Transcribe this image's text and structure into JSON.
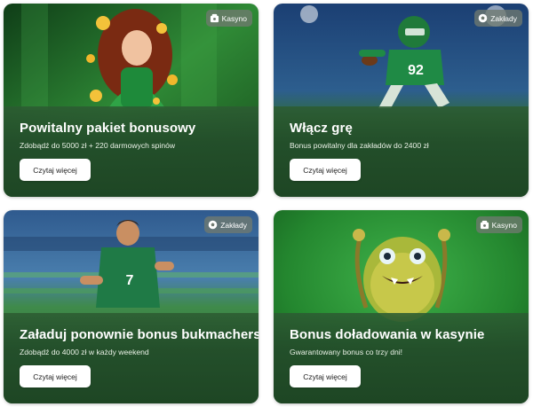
{
  "colors": {
    "panel": "#234e2a",
    "button_bg": "#ffffff",
    "badge_bg": "#707a70"
  },
  "cards": [
    {
      "title": "Powitalny pakiet bonusowy",
      "subtitle": "Zdobądź do 5000 zł + 220 darmowych spinów",
      "button": "Czytaj więcej",
      "badge": {
        "label": "Kasyno",
        "icon": "casino-chip-icon"
      },
      "image": "casino-woman-gold-coins-illustration"
    },
    {
      "title": "Włącz grę",
      "subtitle": "Bonus powitalny dla zakładów do 2400 zł",
      "button": "Czytaj więcej",
      "badge": {
        "label": "Zakłady",
        "icon": "soccer-ball-icon"
      },
      "image": "american-football-player-illustration"
    },
    {
      "title": "Załaduj ponownie bonus bukmacherski",
      "subtitle": "Zdobądź do 4000 zł w każdy weekend",
      "button": "Czytaj więcej",
      "badge": {
        "label": "Zakłady",
        "icon": "soccer-ball-icon"
      },
      "image": "soccer-player-stadium-illustration"
    },
    {
      "title": "Bonus doładowania w kasynie",
      "subtitle": "Gwarantowany bonus co trzy dni!",
      "button": "Czytaj więcej",
      "badge": {
        "label": "Kasyno",
        "icon": "casino-chip-icon"
      },
      "image": "green-furry-monster-illustration"
    }
  ]
}
